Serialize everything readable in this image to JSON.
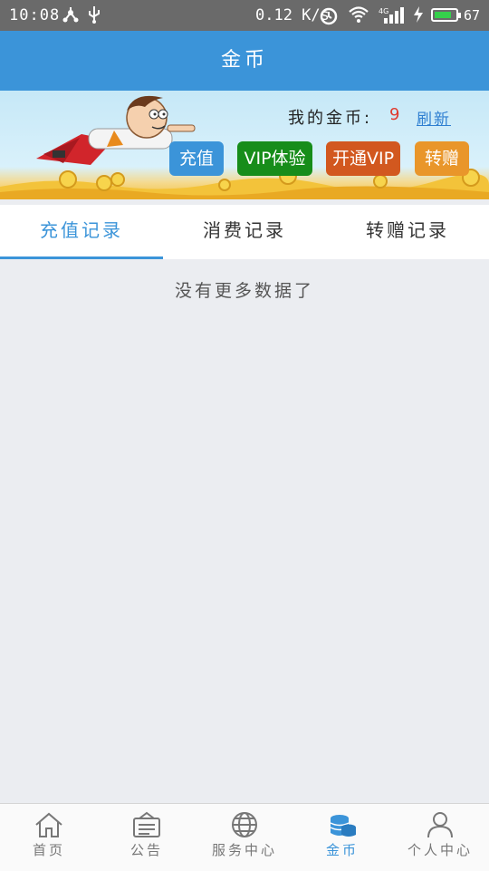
{
  "status_bar": {
    "time": "10:08",
    "speed": "0.12 K/s",
    "battery": "67",
    "battery_level": 0.67
  },
  "header": {
    "title": "金币"
  },
  "banner": {
    "gold_label": "我的金币:",
    "gold_value": "9",
    "refresh_label": "刷新",
    "buttons": {
      "recharge": "充值",
      "vip_trial": "VIP体验",
      "open_vip": "开通VIP",
      "transfer": "转赠"
    }
  },
  "tabs": [
    {
      "label": "充值记录",
      "active": true
    },
    {
      "label": "消费记录",
      "active": false
    },
    {
      "label": "转赠记录",
      "active": false
    }
  ],
  "empty_message": "没有更多数据了",
  "bottom_nav": [
    {
      "label": "首页",
      "icon": "home-icon",
      "active": false
    },
    {
      "label": "公告",
      "icon": "notice-icon",
      "active": false
    },
    {
      "label": "服务中心",
      "icon": "globe-icon",
      "active": false
    },
    {
      "label": "金币",
      "icon": "coins-icon",
      "active": true
    },
    {
      "label": "个人中心",
      "icon": "user-icon",
      "active": false
    }
  ],
  "colors": {
    "primary": "#3b94d9",
    "vip_trial": "#178d1a",
    "open_vip": "#d2581f",
    "transfer": "#e9962a",
    "gold_value": "#e03b2e"
  }
}
